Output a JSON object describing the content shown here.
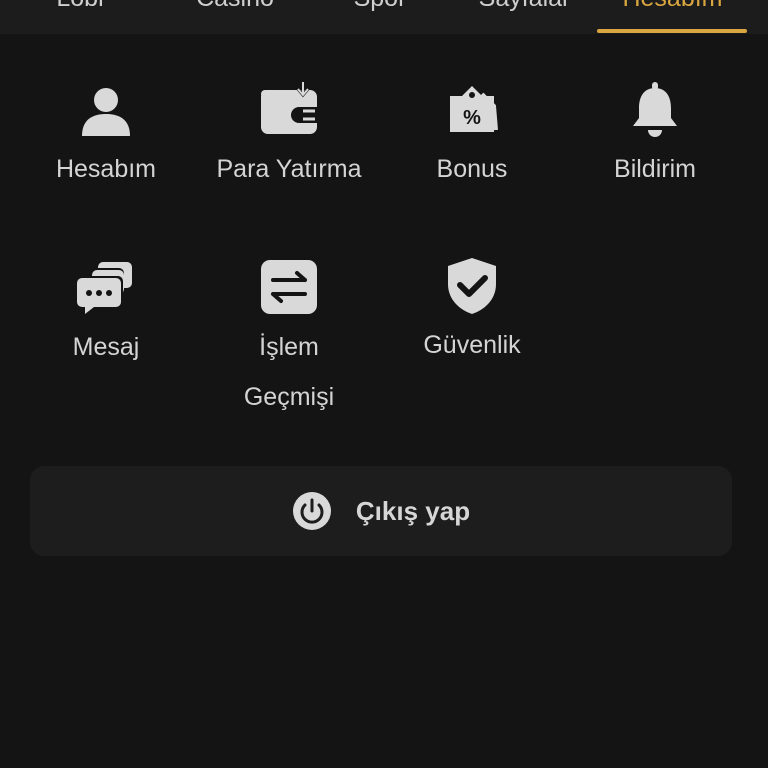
{
  "tabs": [
    {
      "label": "Lobi"
    },
    {
      "label": "Casino"
    },
    {
      "label": "Spor"
    },
    {
      "label": "Sayfalar"
    },
    {
      "label": "Hesabım",
      "active": true
    }
  ],
  "menu": [
    {
      "label": "Hesabım",
      "icon": "user-icon"
    },
    {
      "label": "Para Yatırma",
      "icon": "wallet-deposit-icon"
    },
    {
      "label": "Bonus",
      "icon": "bonus-tag-icon"
    },
    {
      "label": "Bildirim",
      "icon": "bell-icon"
    },
    {
      "label": "Mesaj",
      "icon": "chat-bubbles-icon"
    },
    {
      "label_line1": "İşlem",
      "label_line2": "Geçmişi",
      "icon": "transfer-arrows-icon"
    },
    {
      "label": "Güvenlik",
      "icon": "shield-check-icon"
    }
  ],
  "logout": {
    "label": "Çıkış yap",
    "icon": "power-icon"
  },
  "colors": {
    "background": "#141414",
    "accent": "#d9a640",
    "icon": "#d9d9d9",
    "button_bg": "#1d1d1d"
  }
}
